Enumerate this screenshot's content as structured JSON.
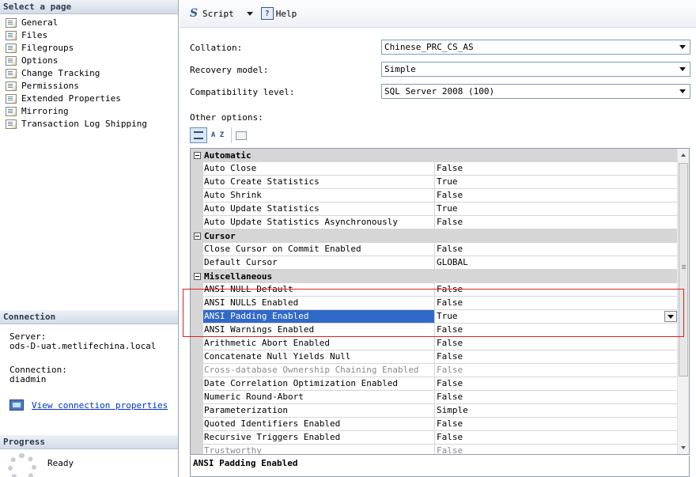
{
  "left_panel": {
    "select_page_header": "Select a page",
    "pages": [
      "General",
      "Files",
      "Filegroups",
      "Options",
      "Change Tracking",
      "Permissions",
      "Extended Properties",
      "Mirroring",
      "Transaction Log Shipping"
    ],
    "connection": {
      "header": "Connection",
      "server_label": "Server:",
      "server_value": "ods-D-uat.metlifechina.local",
      "connection_label": "Connection:",
      "connection_value": "diadmin",
      "link": "View connection properties"
    },
    "progress": {
      "header": "Progress",
      "status": "Ready"
    }
  },
  "toolbar": {
    "script_label": "Script",
    "help_label": "Help"
  },
  "fields": {
    "collation": {
      "label": "Collation:",
      "value": "Chinese_PRC_CS_AS"
    },
    "recovery_model": {
      "label": "Recovery model:",
      "value": "Simple"
    },
    "compatibility_level": {
      "label": "Compatibility level:",
      "value": "SQL Server 2008 (100)"
    }
  },
  "other_options_label": "Other options:",
  "grid_tools": {
    "sort_label": "A Z"
  },
  "grid": {
    "sections": [
      {
        "name": "Automatic",
        "rows": [
          {
            "name": "Auto Close",
            "value": "False"
          },
          {
            "name": "Auto Create Statistics",
            "value": "True"
          },
          {
            "name": "Auto Shrink",
            "value": "False"
          },
          {
            "name": "Auto Update Statistics",
            "value": "True"
          },
          {
            "name": "Auto Update Statistics Asynchronously",
            "value": "False"
          }
        ]
      },
      {
        "name": "Cursor",
        "rows": [
          {
            "name": "Close Cursor on Commit Enabled",
            "value": "False"
          },
          {
            "name": "Default Cursor",
            "value": "GLOBAL"
          }
        ]
      },
      {
        "name": "Miscellaneous",
        "rows": [
          {
            "name": "ANSI NULL Default",
            "value": "False"
          },
          {
            "name": "ANSI NULLS Enabled",
            "value": "False"
          },
          {
            "name": "ANSI Padding Enabled",
            "value": "True",
            "selected": true
          },
          {
            "name": "ANSI Warnings Enabled",
            "value": "False"
          },
          {
            "name": "Arithmetic Abort Enabled",
            "value": "False"
          },
          {
            "name": "Concatenate Null Yields Null",
            "value": "False"
          },
          {
            "name": "Cross-database Ownership Chaining Enabled",
            "value": "False",
            "disabled": true
          },
          {
            "name": "Date Correlation Optimization Enabled",
            "value": "False"
          },
          {
            "name": "Numeric Round-Abort",
            "value": "False"
          },
          {
            "name": "Parameterization",
            "value": "Simple"
          },
          {
            "name": "Quoted Identifiers Enabled",
            "value": "False"
          },
          {
            "name": "Recursive Triggers Enabled",
            "value": "False"
          },
          {
            "name": "Trustworthy",
            "value": "False",
            "disabled": true
          }
        ]
      }
    ]
  },
  "description": "ANSI Padding Enabled",
  "colors": {
    "selection": "#3169c6",
    "highlight_box": "#e02020",
    "link": "#0033cc"
  }
}
